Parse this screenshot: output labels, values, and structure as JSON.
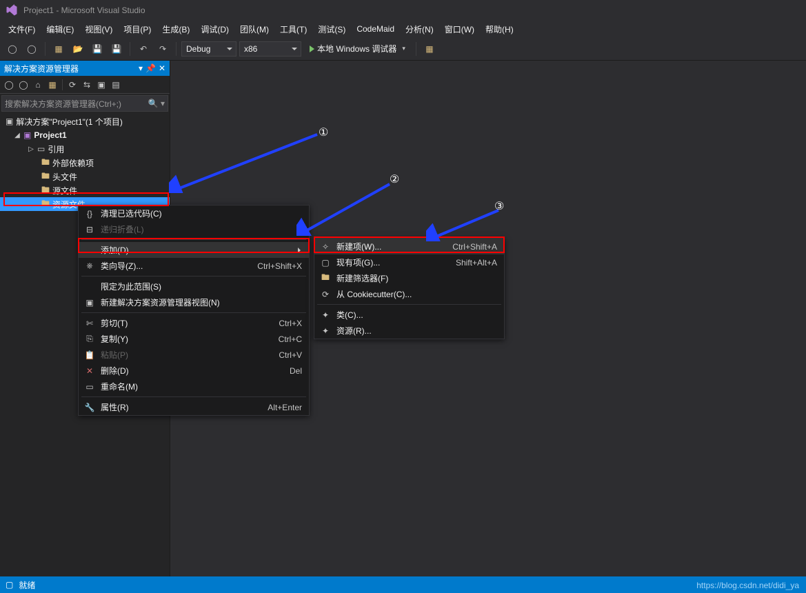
{
  "title": "Project1 - Microsoft Visual Studio",
  "menubar": [
    "文件(F)",
    "编辑(E)",
    "视图(V)",
    "项目(P)",
    "生成(B)",
    "调试(D)",
    "团队(M)",
    "工具(T)",
    "测试(S)",
    "CodeMaid",
    "分析(N)",
    "窗口(W)",
    "帮助(H)"
  ],
  "toolbar": {
    "config": "Debug",
    "platform": "x86",
    "run_label": "本地 Windows 调试器"
  },
  "solution": {
    "panel_title": "解决方案资源管理器",
    "search_placeholder": "搜索解决方案资源管理器(Ctrl+;)",
    "root": "解决方案\"Project1\"(1 个项目)",
    "project": "Project1",
    "nodes": [
      "引用",
      "外部依赖项",
      "头文件",
      "源文件",
      "资源文件"
    ]
  },
  "ctx1": {
    "items": [
      {
        "label": "清理已选代码(C)",
        "icon": "braces"
      },
      {
        "label": "递归折叠(L)",
        "disabled": true,
        "icon": "collapse"
      },
      {
        "label": "添加(D)",
        "hi": true,
        "sub": true
      },
      {
        "label": "类向导(Z)...",
        "shortcut": "Ctrl+Shift+X",
        "icon": "wizard"
      },
      {
        "label": "限定为此范围(S)"
      },
      {
        "label": "新建解决方案资源管理器视图(N)",
        "icon": "newview"
      },
      {
        "label": "剪切(T)",
        "shortcut": "Ctrl+X",
        "icon": "cut"
      },
      {
        "label": "复制(Y)",
        "shortcut": "Ctrl+C",
        "icon": "copy"
      },
      {
        "label": "粘贴(P)",
        "shortcut": "Ctrl+V",
        "disabled": true,
        "icon": "paste"
      },
      {
        "label": "删除(D)",
        "shortcut": "Del",
        "icon": "delete"
      },
      {
        "label": "重命名(M)",
        "icon": "rename"
      },
      {
        "label": "属性(R)",
        "shortcut": "Alt+Enter",
        "icon": "wrench"
      }
    ]
  },
  "ctx2": {
    "items": [
      {
        "label": "新建项(W)...",
        "shortcut": "Ctrl+Shift+A",
        "hi": true,
        "icon": "newitem"
      },
      {
        "label": "现有项(G)...",
        "shortcut": "Shift+Alt+A",
        "icon": "existing"
      },
      {
        "label": "新建筛选器(F)",
        "icon": "folder"
      },
      {
        "label": "从 Cookiecutter(C)...",
        "icon": "cookie"
      },
      {
        "label": "类(C)...",
        "icon": "class"
      },
      {
        "label": "资源(R)...",
        "icon": "resource"
      }
    ]
  },
  "status": {
    "text": "就绪"
  },
  "watermark": "https://blog.csdn.net/didi_ya",
  "annotations": {
    "a1": "①",
    "a2": "②",
    "a3": "③"
  }
}
